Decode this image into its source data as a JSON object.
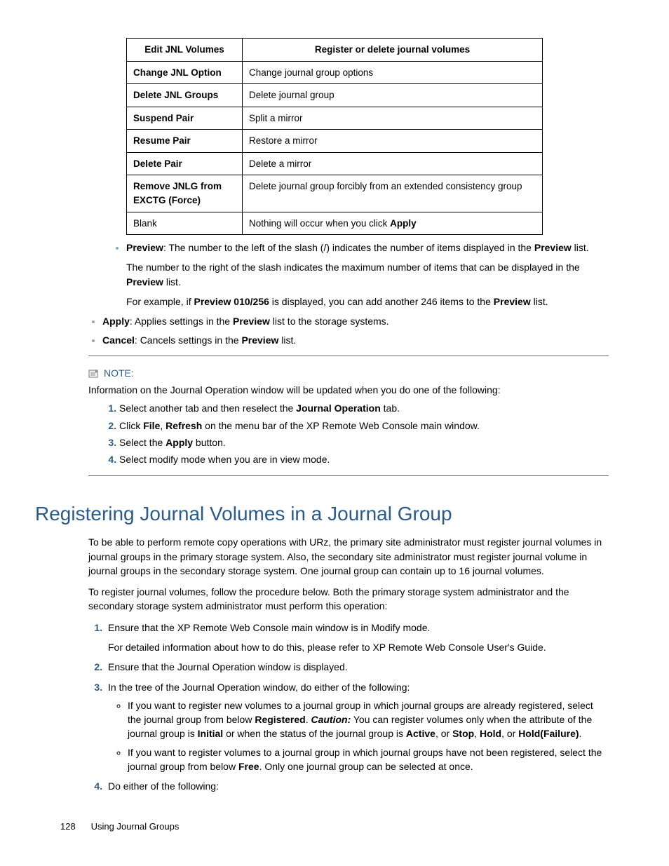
{
  "table": {
    "h1": "Edit JNL Volumes",
    "h2": "Register or delete journal volumes",
    "rows": [
      {
        "l": "Change JNL Option",
        "r": "Change journal group options"
      },
      {
        "l": "Delete JNL Groups",
        "r": "Delete journal group"
      },
      {
        "l": "Suspend Pair",
        "r": "Split a mirror"
      },
      {
        "l": "Resume Pair",
        "r": "Restore a mirror"
      },
      {
        "l": "Delete Pair",
        "r": "Delete a mirror"
      },
      {
        "l": "Remove JNLG from EXCTG (Force)",
        "r": "Delete journal group forcibly from an extended consistency group"
      },
      {
        "l": "Blank",
        "r_pre": "Nothing will occur when you click ",
        "r_b": "Apply"
      }
    ]
  },
  "bullets": {
    "preview_label": "Preview",
    "preview_text": ": The number to the left of the slash (/) indicates the number of items displayed in the ",
    "preview_b": "Preview",
    "preview_text2": " list.",
    "preview_sub1_pre": "The number to the right of the slash indicates the maximum number of items that can be displayed in the ",
    "preview_sub1_b": "Preview",
    "preview_sub1_post": " list.",
    "preview_sub2_pre": "For example, if ",
    "preview_sub2_b": "Preview 010/256",
    "preview_sub2_post": " is displayed, you can add another 246 items to the ",
    "preview_sub2_b2": "Preview",
    "preview_sub2_end": " list.",
    "apply_label": "Apply",
    "apply_text": ": Applies settings in the ",
    "apply_b": "Preview",
    "apply_text2": " list to the storage systems.",
    "cancel_label": "Cancel",
    "cancel_text": ": Cancels settings in the ",
    "cancel_b": "Preview",
    "cancel_text2": " list."
  },
  "note": {
    "label": "NOTE:",
    "intro": "Information on the Journal Operation window will be updated when you do one of the following:",
    "items": {
      "i1_pre": "Select another tab and then reselect the ",
      "i1_b": "Journal Operation",
      "i1_post": " tab.",
      "i2_pre": "Click ",
      "i2_b1": "File",
      "i2_mid": ", ",
      "i2_b2": "Refresh",
      "i2_post": " on the menu bar of the XP Remote Web Console main window.",
      "i3_pre": "Select the ",
      "i3_b": "Apply",
      "i3_post": " button.",
      "i4": "Select modify mode when you are in view mode."
    }
  },
  "heading": "Registering Journal Volumes in a Journal Group",
  "p1": "To be able to perform remote copy operations with URz, the primary site administrator must register journal volumes in journal groups in the primary storage system. Also, the secondary site administrator must register journal volume in journal groups in the secondary storage system. One journal group can contain up to 16 journal volumes.",
  "p2": "To register journal volumes, follow the procedure below. Both the primary storage system administrator and the secondary storage system administrator must perform this operation:",
  "steps": {
    "s1": "Ensure that the XP Remote Web Console main window is in Modify mode.",
    "s1sub": "For detailed information about how to do this, please refer to XP Remote Web Console User's Guide.",
    "s2": "Ensure that the Journal Operation window is displayed.",
    "s3": "In the tree of the Journal Operation window, do either of the following:",
    "s3a_pre": "If you want to register new volumes to a journal group in which journal groups are already registered, select the journal group from below ",
    "s3a_b1": "Registered",
    "s3a_mid": ". ",
    "s3a_caution": "Caution:",
    "s3a_post1": " You can register volumes only when the attribute of the journal group is ",
    "s3a_b2": "Initial",
    "s3a_post2": " or when the status of the journal group is ",
    "s3a_b3": "Active",
    "s3a_post3": ", or ",
    "s3a_b4": "Stop",
    "s3a_post4": ", ",
    "s3a_b5": "Hold",
    "s3a_post5": ", or ",
    "s3a_b6": "Hold(Failure)",
    "s3a_end": ".",
    "s3b_pre": "If you want to register volumes to a journal group in which journal groups have not been registered, select the journal group from below ",
    "s3b_b": "Free",
    "s3b_post": ". Only one journal group can be selected at once.",
    "s4": "Do either of the following:"
  },
  "footer": {
    "pageno": "128",
    "section": "Using Journal Groups"
  }
}
